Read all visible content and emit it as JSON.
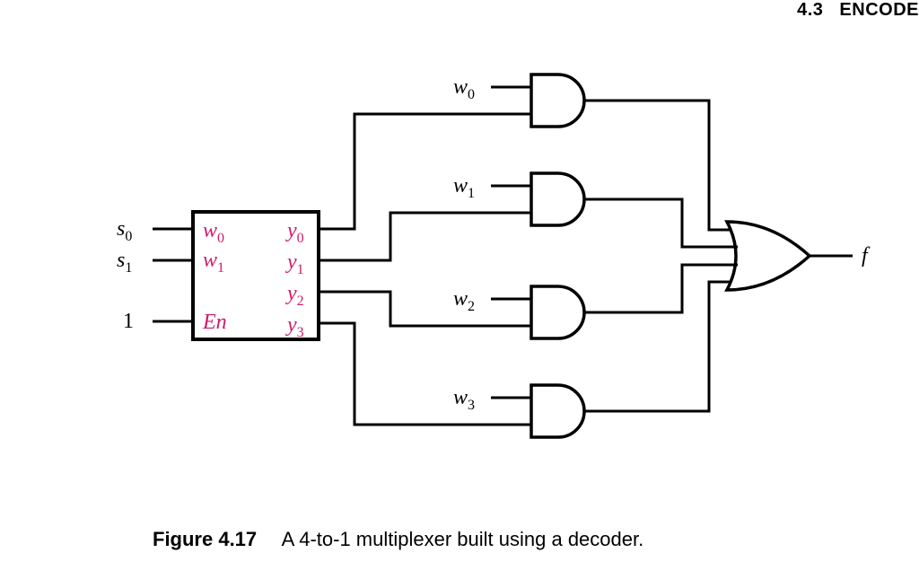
{
  "header": {
    "section_number": "4.3",
    "section_title": "ENCODE"
  },
  "caption": {
    "label": "Figure 4.17",
    "description": "A 4-to-1 multiplexer built using a decoder."
  },
  "diagram": {
    "external_inputs": {
      "s0": {
        "base": "s",
        "sub": "0"
      },
      "s1": {
        "base": "s",
        "sub": "1"
      },
      "en_const": "1"
    },
    "decoder": {
      "inputs": {
        "w0": {
          "base": "w",
          "sub": "0"
        },
        "w1": {
          "base": "w",
          "sub": "1"
        },
        "en": "En"
      },
      "outputs": {
        "y0": {
          "base": "y",
          "sub": "0"
        },
        "y1": {
          "base": "y",
          "sub": "1"
        },
        "y2": {
          "base": "y",
          "sub": "2"
        },
        "y3": {
          "base": "y",
          "sub": "3"
        }
      }
    },
    "and_inputs": {
      "w0": {
        "base": "w",
        "sub": "0"
      },
      "w1": {
        "base": "w",
        "sub": "1"
      },
      "w2": {
        "base": "w",
        "sub": "2"
      },
      "w3": {
        "base": "w",
        "sub": "3"
      }
    },
    "output": "f"
  },
  "colors": {
    "decoder_label": "#d11a6b",
    "stroke": "#000000"
  }
}
